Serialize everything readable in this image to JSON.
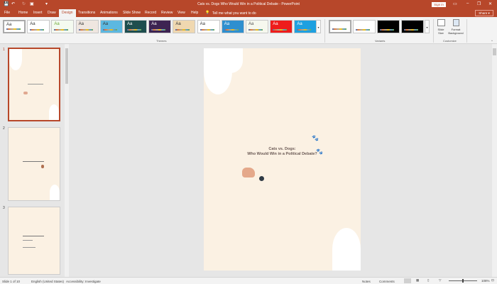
{
  "window": {
    "title": "Cats vs. Dogs Who Would Win in a Political Debate  -  PowerPoint",
    "sign_in": "Sign in",
    "share": "Share"
  },
  "quick_access": {
    "save": "💾",
    "undo": "↶",
    "redo": "↻",
    "present": "▣",
    "more": "▾"
  },
  "tabs": [
    "File",
    "Home",
    "Insert",
    "Draw",
    "Design",
    "Transitions",
    "Animations",
    "Slide Show",
    "Record",
    "Review",
    "View",
    "Help"
  ],
  "active_tab": "Design",
  "tell_me": "Tell me what you want to do",
  "ribbon": {
    "themes_label": "Themes",
    "variants_label": "Variants",
    "customize_label": "Customize",
    "themes": [
      {
        "bg": "#ffffff",
        "fg": "#333"
      },
      {
        "bg": "#ffffff",
        "fg": "#333"
      },
      {
        "bg": "#f4faf0",
        "fg": "#6aa832"
      },
      {
        "bg": "#efe6e0",
        "fg": "#333"
      },
      {
        "bg": "#5cb8e0",
        "fg": "#333"
      },
      {
        "bg": "#1e4e4e",
        "fg": "#fff"
      },
      {
        "bg": "#3d2452",
        "fg": "#fff"
      },
      {
        "bg": "#f0d8b0",
        "fg": "#333"
      },
      {
        "bg": "#ffffff",
        "fg": "#333"
      },
      {
        "bg": "#2e8fcf",
        "fg": "#fff"
      },
      {
        "bg": "#f6f8ee",
        "fg": "#555"
      },
      {
        "bg": "#ee1c1c",
        "fg": "#fff"
      },
      {
        "bg": "#1ea0e0",
        "fg": "#fff"
      }
    ],
    "theme_sample": "Aa",
    "variants": [
      "#ffffff",
      "#ffffff",
      "#000000",
      "#000000"
    ],
    "slide_size": "Slide Size",
    "format_background": "Format Background"
  },
  "slides": [
    {
      "num": "1",
      "title": "Cats vs. Dogs:",
      "subtitle": "Who Would Win in a Political Debate?"
    },
    {
      "num": "2"
    },
    {
      "num": "3"
    }
  ],
  "status": {
    "slide": "Slide 1 of 10",
    "language": "English (United States)",
    "accessibility": "Accessibility: Investigate",
    "notes": "Notes",
    "comments": "Comments",
    "zoom": "108%"
  }
}
